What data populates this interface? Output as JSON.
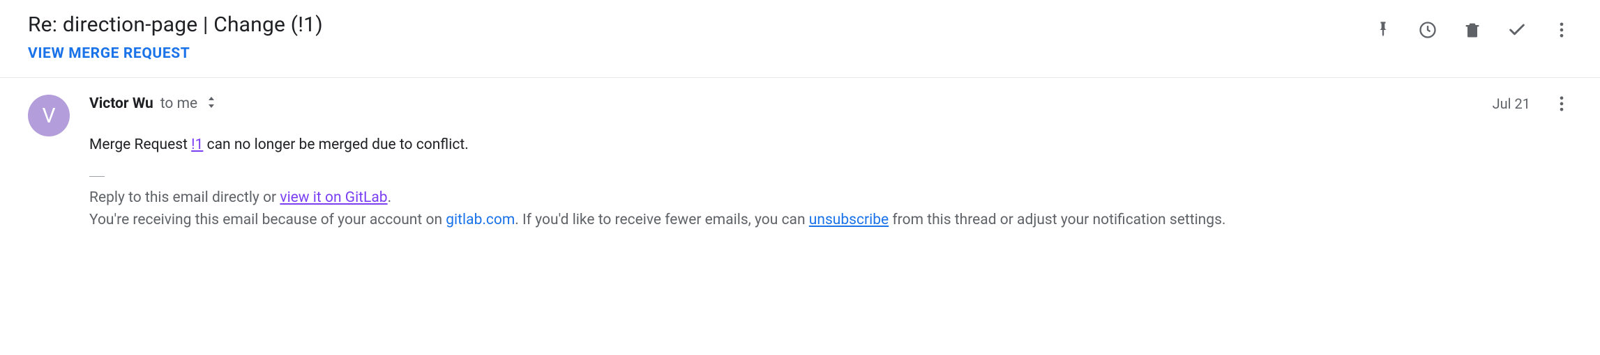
{
  "header": {
    "subject": "Re: direction-page | Change (!1)",
    "view_mr_label": "VIEW MERGE REQUEST"
  },
  "sender": {
    "avatar_initial": "V",
    "name": "Victor Wu",
    "to_text": "to me",
    "date": "Jul 21"
  },
  "body": {
    "line_prefix": "Merge Request ",
    "mr_ref": "!1",
    "line_suffix": " can no longer be merged due to conflict."
  },
  "footer": {
    "reply_prefix": "Reply to this email directly or ",
    "view_link": "view it on GitLab",
    "period1": ".",
    "receiving_prefix": "You're receiving this email because of your account on ",
    "domain": "gitlab.com",
    "receiving_mid": ". If you'd like to receive fewer emails, you can ",
    "unsubscribe": "unsubscribe",
    "receiving_suffix": " from this thread or adjust your notification settings."
  }
}
